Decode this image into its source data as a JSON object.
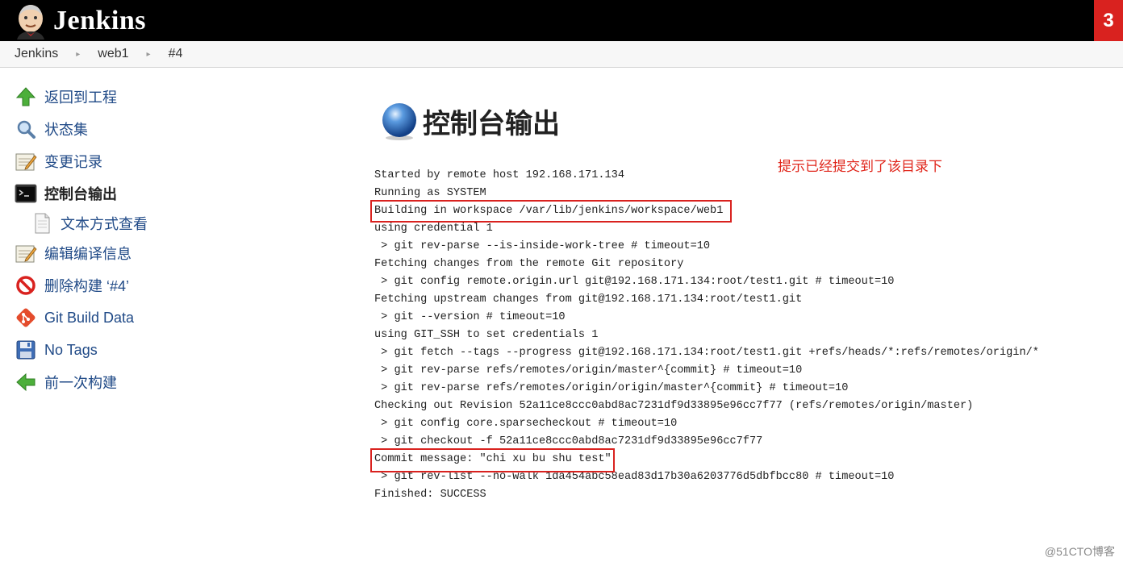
{
  "header": {
    "app_title": "Jenkins",
    "notification_count": "3"
  },
  "breadcrumb": {
    "items": [
      "Jenkins",
      "web1",
      "#4"
    ],
    "separator": "▸"
  },
  "sidebar": {
    "items": [
      {
        "label": "返回到工程",
        "icon": "up-arrow-icon"
      },
      {
        "label": "状态集",
        "icon": "magnifier-icon"
      },
      {
        "label": "变更记录",
        "icon": "notepad-icon"
      },
      {
        "label": "控制台输出",
        "icon": "terminal-icon",
        "active": true
      },
      {
        "label": "文本方式查看",
        "icon": "document-icon",
        "sub": true
      },
      {
        "label": "编辑编译信息",
        "icon": "notepad-icon"
      },
      {
        "label": "删除构建 ‘#4’",
        "icon": "no-entry-icon"
      },
      {
        "label": "Git Build Data",
        "icon": "git-icon"
      },
      {
        "label": "No Tags",
        "icon": "floppy-disk-icon"
      },
      {
        "label": "前一次构建",
        "icon": "left-arrow-icon"
      }
    ]
  },
  "main": {
    "title": "控制台输出",
    "annotation": "提示已经提交到了该目录下",
    "console_lines": [
      "Started by remote host 192.168.171.134",
      "Running as SYSTEM",
      "Building in workspace /var/lib/jenkins/workspace/web1",
      "using credential 1",
      " > git rev-parse --is-inside-work-tree # timeout=10",
      "Fetching changes from the remote Git repository",
      " > git config remote.origin.url git@192.168.171.134:root/test1.git # timeout=10",
      "Fetching upstream changes from git@192.168.171.134:root/test1.git",
      " > git --version # timeout=10",
      "using GIT_SSH to set credentials 1",
      " > git fetch --tags --progress git@192.168.171.134:root/test1.git +refs/heads/*:refs/remotes/origin/*",
      " > git rev-parse refs/remotes/origin/master^{commit} # timeout=10",
      " > git rev-parse refs/remotes/origin/origin/master^{commit} # timeout=10",
      "Checking out Revision 52a11ce8ccc0abd8ac7231df9d33895e96cc7f77 (refs/remotes/origin/master)",
      " > git config core.sparsecheckout # timeout=10",
      " > git checkout -f 52a11ce8ccc0abd8ac7231df9d33895e96cc7f77",
      "Commit message: \"chi xu bu shu test\"",
      " > git rev-list --no-walk 1da454abc58ead83d17b30a6203776d5dbfbcc80 # timeout=10",
      "Finished: SUCCESS"
    ]
  },
  "watermark": "@51CTO博客",
  "colors": {
    "topbar": "#000000",
    "notification": "#d9221f",
    "highlight": "#d9221f",
    "annotation": "#e0251a",
    "link": "#204a87"
  }
}
